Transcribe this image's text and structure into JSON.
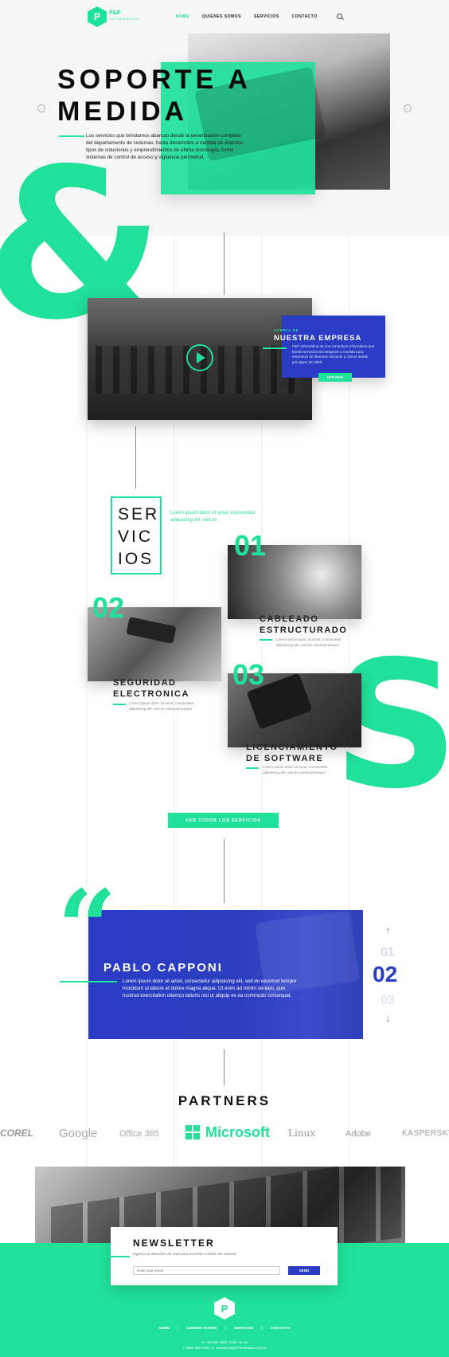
{
  "brand": {
    "name": "P&P",
    "sub": "INFORMATICA",
    "logo_glyph": "P"
  },
  "nav": {
    "items": [
      "HOME",
      "QUIENES SOMOS",
      "SERVICIOS",
      "CONTACTO"
    ],
    "active_color": "#20e19a"
  },
  "hero": {
    "title_line1": "SOPORTE A",
    "title_line2": "MEDIDA",
    "text": "Los servicios que brindamos abarcan desde la tercerización completa del departamento de sistemas, hasta desarrollos a medida de distintos tipos de soluciones y emprendimientos de última tecnología, como sistemas de control de acceso y vigilancia perimetral.",
    "prev_arrow": "←",
    "next_arrow": "→"
  },
  "decor": {
    "ampersand": "&",
    "s_letter": "S"
  },
  "about": {
    "kicker": "ACERCA DE",
    "title": "NUESTRA EMPRESA",
    "text": "P&P Informática es una consultora informática que brinda servicios tecnológicos a medida para empresas de diversos sectores y rubros desde principios de 2003.",
    "button": "VER MAS"
  },
  "services": {
    "title_lines": [
      "SER",
      "VIC",
      "IOS"
    ],
    "intro": "Lorem ipsum dolor sit amet, consectetur adipisicing elit, sed do",
    "items": [
      {
        "num": "01",
        "title1": "CABLEADO",
        "title2": "ESTRUCTURADO",
        "text": "Lorem ipsum dolor sit amet, consectetur adipisicing elit, sed do eiusmod tempor"
      },
      {
        "num": "02",
        "title1": "SEGURIDAD",
        "title2": "ELECTRONICA",
        "text": "Lorem ipsum dolor sit amet, consectetur adipisicing elit, sed do eiusmod tempor"
      },
      {
        "num": "03",
        "title1": "LICENCIAMIENTO",
        "title2": "DE SOFTWARE",
        "text": "Lorem ipsum dolor sit amet, consectetur adipisicing elit, sed do eiusmod tempor"
      }
    ],
    "button": "VER TODOS LOS SERVICIOS"
  },
  "testimonial": {
    "quote_mark": "“",
    "name": "PABLO CAPPONI",
    "text": "Lorem ipsum dolor sit amet, consectetur adipisicing elit, sed do eiusmod tempor incididunt ut labore et dolore magna aliqua. Ut enim ad minim veniam, quis nostrud exercitation ullamco laboris nisi ut aliquip ex ea commodo consequat.",
    "pager": [
      "01",
      "02",
      "03"
    ],
    "up": "↑",
    "down": "↓"
  },
  "partners": {
    "title": "PARTNERS",
    "logos": [
      "COREL",
      "Google",
      "Office 365",
      "Microsoft",
      "Linux",
      "Adobe",
      "KASPERSKY"
    ]
  },
  "newsletter": {
    "title": "NEWSLETTER",
    "subtitle": "Ingresa tu direccion de mail para acceder a todas las noticias",
    "placeholder": "Enter your email",
    "button": "SEND"
  },
  "footer": {
    "nav": [
      "HOME",
      "QUIENES SOMOS",
      "SERVICIOS",
      "CONTACTO"
    ],
    "address": "Av. Avenida 2300, Cadiz, Av. bs",
    "contact": "T: 0800-362-2330 | E: consultas@pyPinformatica.com.ar"
  }
}
